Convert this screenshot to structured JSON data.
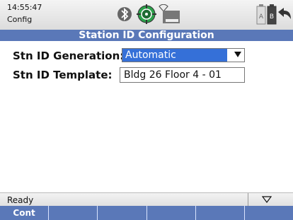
{
  "status_bar": {
    "time": "14:55:47",
    "mode": "Config"
  },
  "title": "Station ID Configuration",
  "fields": {
    "generation_label": "Stn ID Generation:",
    "generation_value": "Automatic",
    "template_label": "Stn ID Template:",
    "template_value": "Bldg 26 Floor 4 - 01"
  },
  "footer": {
    "status_text": "Ready",
    "softkeys": [
      "Cont",
      "",
      "",
      "",
      "",
      ""
    ]
  },
  "colors": {
    "header_blue": "#5a78b8",
    "selection_blue": "#3570d8",
    "gps_green": "#2ba14a"
  },
  "icons": [
    "bluetooth-icon",
    "gps-satellite-icon",
    "wifi-icon",
    "card-icon",
    "battery-a-icon",
    "battery-b-icon",
    "back-arrow-icon"
  ]
}
